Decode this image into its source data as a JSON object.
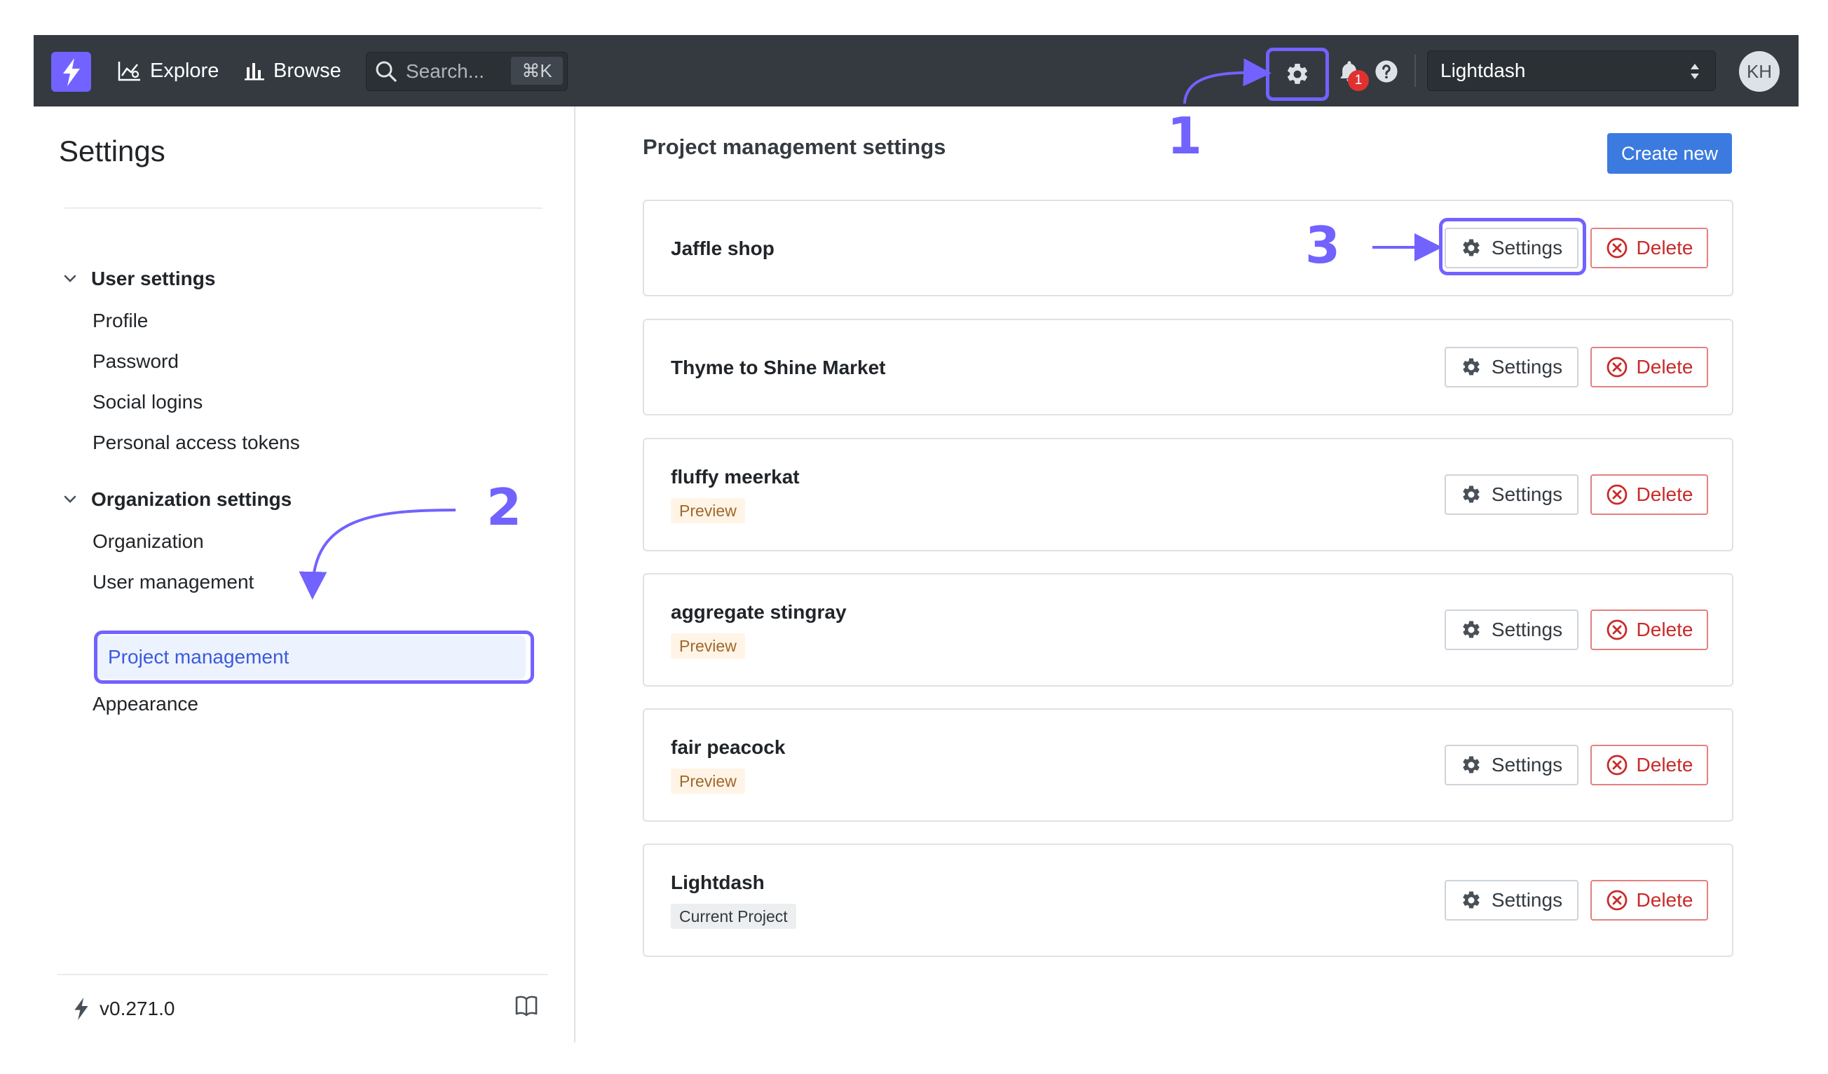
{
  "topnav": {
    "explore_label": "Explore",
    "browse_label": "Browse",
    "search_placeholder": "Search...",
    "search_shortcut": "⌘K",
    "notification_count": "1",
    "project_selected": "Lightdash",
    "avatar_initials": "KH",
    "icons": [
      "lightning-logo-icon",
      "explore-chart-icon",
      "bar-chart-icon",
      "search-icon",
      "gear-icon",
      "bell-icon",
      "help-icon",
      "select-caret-icon"
    ]
  },
  "sidebar": {
    "title": "Settings",
    "groups": [
      {
        "label": "User settings",
        "items": [
          "Profile",
          "Password",
          "Social logins",
          "Personal access tokens"
        ]
      },
      {
        "label": "Organization settings",
        "items": [
          "Organization",
          "User management",
          "Project management",
          "Appearance"
        ]
      }
    ],
    "active_item": "Project management",
    "version": "v0.271.0"
  },
  "main": {
    "title": "Project management settings",
    "create_label": "Create new",
    "settings_label": "Settings",
    "delete_label": "Delete",
    "projects": [
      {
        "name": "Jaffle shop",
        "tag": ""
      },
      {
        "name": "Thyme to Shine Market",
        "tag": ""
      },
      {
        "name": "fluffy meerkat",
        "tag": "Preview"
      },
      {
        "name": "aggregate stingray",
        "tag": "Preview"
      },
      {
        "name": "fair peacock",
        "tag": "Preview"
      },
      {
        "name": "Lightdash",
        "tag": "Current Project"
      }
    ]
  },
  "annotations": {
    "step1": "1",
    "step2": "2",
    "step3": "3"
  },
  "colors": {
    "nav_bg": "#343a40",
    "brand": "#7262ff",
    "primary": "#3b7be0",
    "danger": "#c92a2a",
    "active_bg": "#edf2ff",
    "preview_bg": "#fff4e6"
  }
}
